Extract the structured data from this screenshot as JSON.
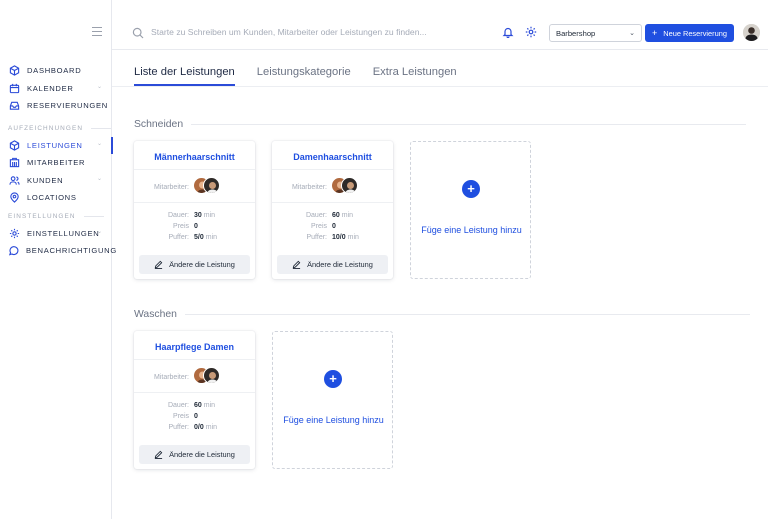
{
  "search": {
    "placeholder": "Starte zu Schreiben um Kunden, Mitarbeiter oder Leistungen zu finden..."
  },
  "header": {
    "shop_select": "Barbershop",
    "new_button": "Neue Reservierung"
  },
  "sidebar": {
    "items_top": [
      {
        "label": "DASHBOARD",
        "icon": "cube-icon"
      },
      {
        "label": "KALENDER",
        "icon": "calendar-icon"
      },
      {
        "label": "RESERVIERUNGEN",
        "icon": "inbox-icon"
      }
    ],
    "section_records": "AUFZEICHNUNGEN",
    "items_records": [
      {
        "label": "LEISTUNGEN",
        "icon": "cube-icon"
      },
      {
        "label": "MITARBEITER",
        "icon": "building-icon"
      },
      {
        "label": "KUNDEN",
        "icon": "users-icon"
      },
      {
        "label": "LOCATIONS",
        "icon": "location-icon"
      }
    ],
    "section_settings": "EINSTELLUNGEN",
    "items_settings": [
      {
        "label": "EINSTELLUNGEN",
        "icon": "gear-icon"
      },
      {
        "label": "BENACHRICHTIGUNG",
        "icon": "chat-icon"
      }
    ]
  },
  "tabs": [
    "Liste der Leistungen",
    "Leistungskategorie",
    "Extra Leistungen"
  ],
  "labels": {
    "staff": "Mitarbeiter:",
    "duration": "Dauer:",
    "price": "Preis",
    "buffer": "Puffer:",
    "min": "min",
    "edit": "Ändere die Leistung",
    "add": "Füge eine Leistung hinzu"
  },
  "categories": [
    {
      "name": "Schneiden",
      "services": [
        {
          "name": "Männerhaarschnitt",
          "duration": "30",
          "price": "0",
          "buffer": "5/0"
        },
        {
          "name": "Damenhaarschnitt",
          "duration": "60",
          "price": "0",
          "buffer": "10/0"
        }
      ]
    },
    {
      "name": "Waschen",
      "services": [
        {
          "name": "Haarpflege Damen",
          "duration": "60",
          "price": "0",
          "buffer": "0/0"
        }
      ]
    }
  ],
  "colors": {
    "accent": "#1f4fe0",
    "muted": "#a6acb8"
  }
}
